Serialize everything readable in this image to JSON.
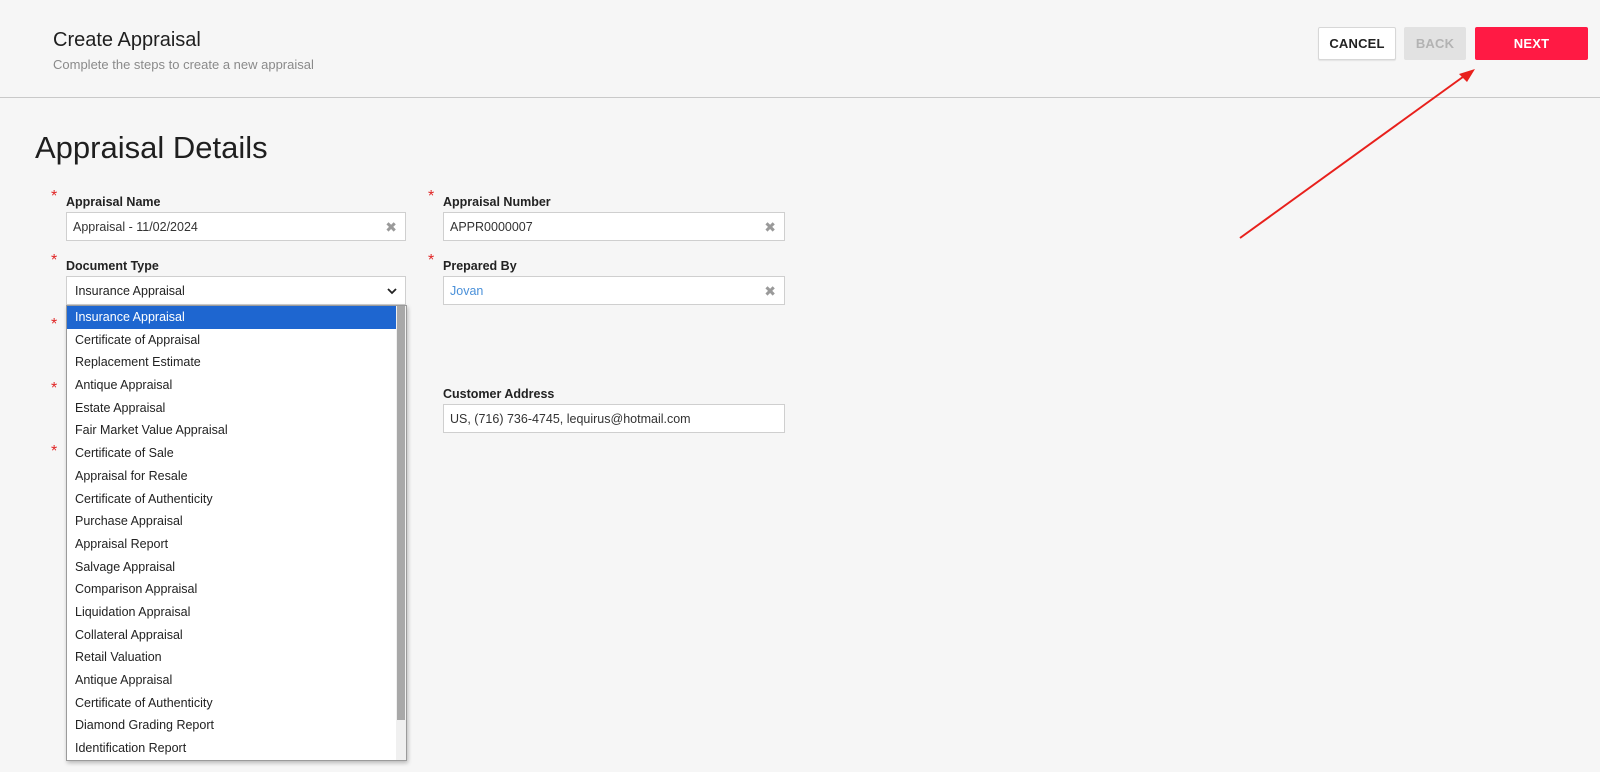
{
  "header": {
    "title": "Create Appraisal",
    "subtitle": "Complete the steps to create a new appraisal",
    "cancel_label": "CANCEL",
    "back_label": "BACK",
    "next_label": "NEXT"
  },
  "section": {
    "title": "Appraisal Details"
  },
  "required_marker": "*",
  "fields": {
    "appraisal_name": {
      "label": "Appraisal Name",
      "value": "Appraisal - 11/02/2024"
    },
    "appraisal_number": {
      "label": "Appraisal Number",
      "value": "APPR0000007"
    },
    "document_type": {
      "label": "Document Type",
      "value": "Insurance Appraisal"
    },
    "prepared_by": {
      "label": "Prepared By",
      "value": "Jovan"
    },
    "customer_address": {
      "label": "Customer Address",
      "value": "US, (716) 736-4745, lequirus@hotmail.com"
    }
  },
  "document_type_options": [
    "Insurance Appraisal",
    "Certificate of Appraisal",
    "Replacement Estimate",
    "Antique Appraisal",
    "Estate Appraisal",
    "Fair Market Value Appraisal",
    "Certificate of Sale",
    "Appraisal for Resale",
    "Certificate of Authenticity",
    "Purchase Appraisal",
    "Appraisal Report",
    "Salvage Appraisal",
    "Comparison Appraisal",
    "Liquidation Appraisal",
    "Collateral Appraisal",
    "Retail Valuation",
    "Antique Appraisal",
    "Certificate of Authenticity",
    "Diamond Grading Report",
    "Identification Report"
  ],
  "selected_option_index": 0,
  "icons": {
    "clear": "clear-x-icon",
    "dropdown": "chevron-down-icon",
    "annotation": "red-arrow"
  },
  "colors": {
    "accent": "#ff1a44",
    "required": "#e02525",
    "link": "#4a90d9",
    "selection": "#1e66d0",
    "annotation_arrow": "#e8201c"
  }
}
